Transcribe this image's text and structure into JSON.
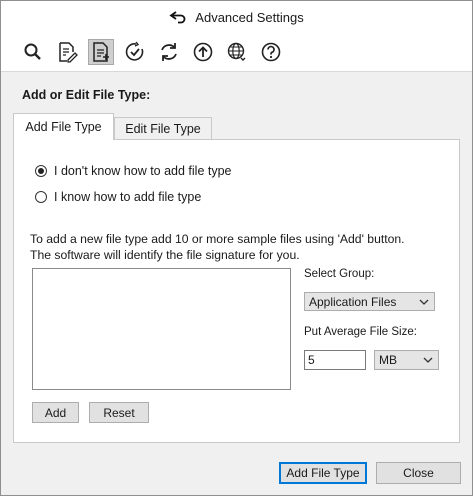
{
  "window": {
    "title": "Advanced Settings",
    "title_icon": "back-arrow-icon"
  },
  "toolbar": {
    "icons": [
      "search-icon",
      "file-edit-icon",
      "file-type-icon",
      "clock-check-icon",
      "refresh-icon",
      "upload-icon",
      "globe-settings-icon",
      "help-icon"
    ],
    "active": "file-type-icon"
  },
  "section": {
    "label": "Add or Edit File Type:"
  },
  "tabs": [
    {
      "label": "Add File Type",
      "active": true
    },
    {
      "label": "Edit File Type",
      "active": false
    }
  ],
  "options": [
    {
      "label": "I don't know how to add file type",
      "selected": true
    },
    {
      "label": "I know how to add file type",
      "selected": false
    }
  ],
  "description": "To add a new file type add 10 or more sample files using 'Add' button. The software will identify the file signature for you.",
  "group": {
    "label": "Select Group:",
    "value": "Application Files"
  },
  "size": {
    "label": "Put  Average File Size:",
    "value": "5",
    "unit": "MB"
  },
  "list_buttons": {
    "add": "Add",
    "reset": "Reset"
  },
  "footer": {
    "add_file_type": "Add File Type",
    "close": "Close"
  }
}
